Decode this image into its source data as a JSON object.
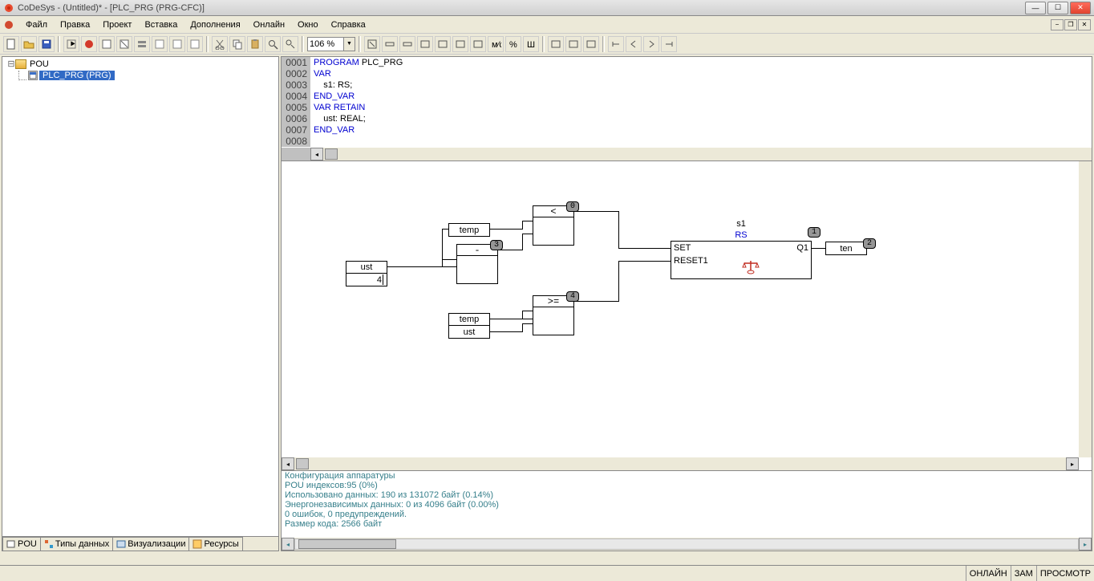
{
  "window": {
    "title": "CoDeSys - (Untitled)* - [PLC_PRG (PRG-CFC)]"
  },
  "menu": {
    "file": "Файл",
    "edit": "Правка",
    "project": "Проект",
    "insert": "Вставка",
    "extras": "Дополнения",
    "online": "Онлайн",
    "window": "Окно",
    "help": "Справка"
  },
  "zoom": {
    "value": "106 %"
  },
  "tree": {
    "root": "POU",
    "item": "PLC_PRG (PRG)"
  },
  "tabs": {
    "pou": "POU",
    "types": "Типы данных",
    "vis": "Визуализации",
    "res": "Ресурсы"
  },
  "code": {
    "ln1": "0001",
    "tx1a": "PROGRAM ",
    "tx1b": "PLC_PRG",
    "ln2": "0002",
    "tx2": "VAR",
    "ln3": "0003",
    "tx3a": "    s1: ",
    "tx3b": "RS",
    "tx3c": ";",
    "ln4": "0004",
    "tx4": "END_VAR",
    "ln5": "0005",
    "tx5": "VAR RETAIN",
    "ln6": "0006",
    "tx6a": "    ust: ",
    "tx6b": "REAL",
    "tx6c": ";",
    "ln7": "0007",
    "tx7": "END_VAR",
    "ln8": "0008"
  },
  "cfc": {
    "temp1": "temp",
    "ust": "ust",
    "val4": "4",
    "minus": "-",
    "lt": "<",
    "ge": ">=",
    "temp2": "temp",
    "ust2": "ust",
    "s1": "s1",
    "rs": "RS",
    "set": "SET",
    "reset": "RESET1",
    "q1": "Q1",
    "ten": "ten",
    "n0": "0",
    "n1": "1",
    "n2": "2",
    "n3": "3",
    "n4": "4"
  },
  "msg": {
    "l1": "Конфигурация аппаратуры",
    "l2": "POU индексов:95 (0%)",
    "l3": "Использовано данных: 190 из 131072 байт (0.14%)",
    "l4": "Энергонезависимых данных: 0 из 4096 байт (0.00%)",
    "l5": "0 ошибок, 0 предупреждений.",
    "l6": "Размер кода: 2566 байт"
  },
  "status": {
    "online": "ОНЛАЙН",
    "ovr": "ЗАМ",
    "view": "ПРОСМОТР"
  }
}
